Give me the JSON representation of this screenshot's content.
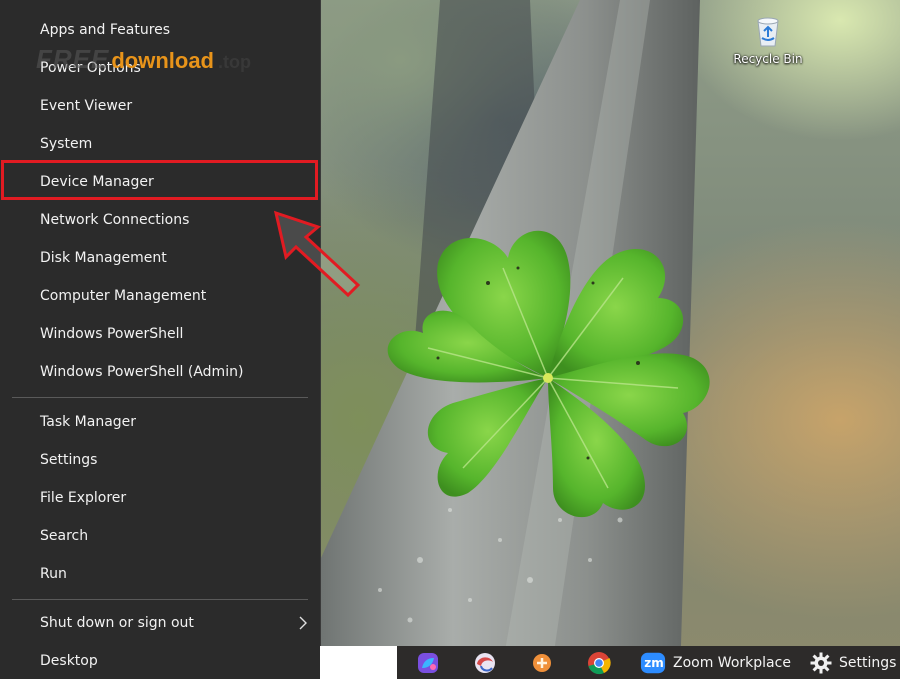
{
  "menu": {
    "items_group1": [
      {
        "label": "Apps and Features"
      },
      {
        "label": "Power Options"
      },
      {
        "label": "Event Viewer"
      },
      {
        "label": "System"
      },
      {
        "label": "Device Manager",
        "highlighted": true
      },
      {
        "label": "Network Connections"
      },
      {
        "label": "Disk Management"
      },
      {
        "label": "Computer Management"
      },
      {
        "label": "Windows PowerShell"
      },
      {
        "label": "Windows PowerShell (Admin)"
      }
    ],
    "items_group2": [
      {
        "label": "Task Manager"
      },
      {
        "label": "Settings"
      },
      {
        "label": "File Explorer"
      },
      {
        "label": "Search"
      },
      {
        "label": "Run"
      }
    ],
    "items_group3": [
      {
        "label": "Shut down or sign out",
        "has_submenu": true
      },
      {
        "label": "Desktop"
      }
    ]
  },
  "desktop": {
    "recycle_bin_label": "Recycle Bin"
  },
  "watermark": {
    "part1": "FREE",
    "part2": "download",
    "part3": ".top"
  },
  "taskbar": {
    "zoom_badge": "zm",
    "zoom_label": "Zoom Workplace",
    "settings_label": "Settings"
  },
  "colors": {
    "menu_bg": "#2b2b2b",
    "highlight_red": "#e11b22",
    "clover_green": "#5fbf3a",
    "taskbar_bg": "#2d2b2a"
  }
}
